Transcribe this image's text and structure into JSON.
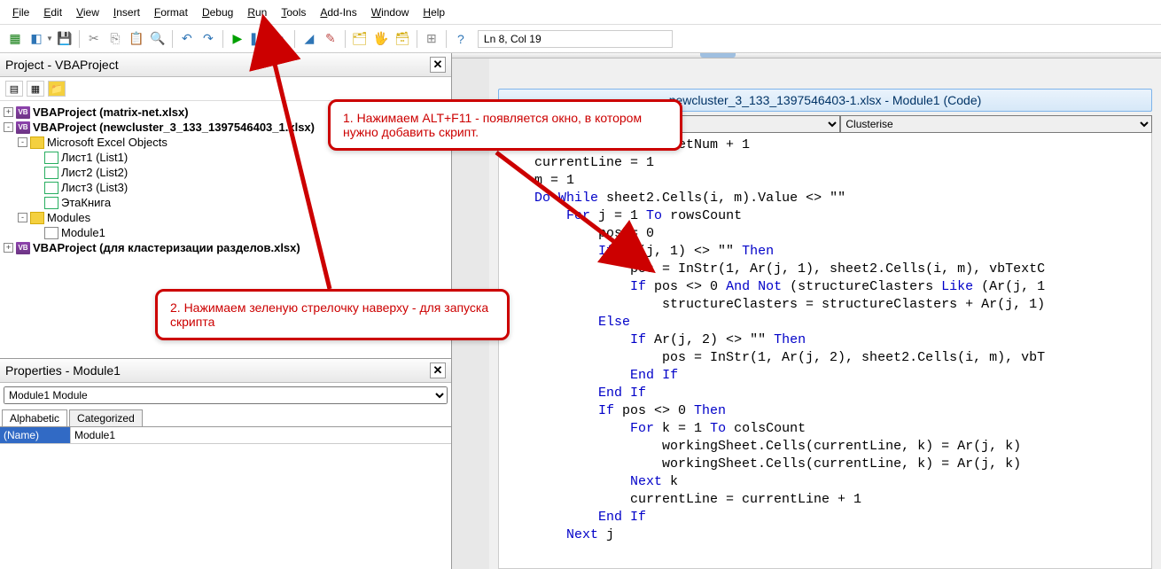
{
  "menu": [
    "File",
    "Edit",
    "View",
    "Insert",
    "Format",
    "Debug",
    "Run",
    "Tools",
    "Add-Ins",
    "Window",
    "Help"
  ],
  "status": "Ln 8, Col 19",
  "project_header": "Project - VBAProject",
  "tree": [
    {
      "ind": 0,
      "exp": "+",
      "icon": "vba",
      "text": "VBAProject (matrix-net.xlsx)",
      "bold": true
    },
    {
      "ind": 0,
      "exp": "-",
      "icon": "vba",
      "text": "VBAProject (newcluster_3_133_1397546403_1.xlsx)",
      "bold": true
    },
    {
      "ind": 1,
      "exp": "-",
      "icon": "fold",
      "text": "Microsoft Excel Objects"
    },
    {
      "ind": 2,
      "exp": "",
      "icon": "sheet",
      "text": "Лист1 (List1)"
    },
    {
      "ind": 2,
      "exp": "",
      "icon": "sheet",
      "text": "Лист2 (List2)"
    },
    {
      "ind": 2,
      "exp": "",
      "icon": "sheet",
      "text": "Лист3 (List3)"
    },
    {
      "ind": 2,
      "exp": "",
      "icon": "sheet",
      "text": "ЭтаКнига"
    },
    {
      "ind": 1,
      "exp": "-",
      "icon": "fold",
      "text": "Modules"
    },
    {
      "ind": 2,
      "exp": "",
      "icon": "mod",
      "text": "Module1"
    },
    {
      "ind": 0,
      "exp": "+",
      "icon": "vba",
      "text": "VBAProject (для кластеризации разделов.xlsx)",
      "bold": true
    }
  ],
  "properties_header": "Properties - Module1",
  "prop_selector": "Module1 Module",
  "prop_tabs": [
    "Alphabetic",
    "Categorized"
  ],
  "prop_name_key": "(Name)",
  "prop_name_val": "Module1",
  "code_title": "newcluster_3_133_1397546403-1.xlsx - Module1 (Code)",
  "code_left_sel": "",
  "code_right_sel": "Clusterise",
  "callout1": "1. Нажимаем ALT+F11  - появляется окно, в котором нужно добавить скрипт.",
  "callout2": "2.  Нажимаем зеленую стрелочку наверху - для запуска скрипта",
  "code_lines": [
    {
      "t": "etNum = workingSheetNum + 1",
      "ind": 0
    },
    {
      "t": "currentLine = 1",
      "ind": 0
    },
    {
      "t": "m = 1",
      "ind": 0
    },
    {
      "t": "Do While sheet2.Cells(i, m).Value <> \"\"",
      "ind": 0,
      "kw": [
        "Do",
        "While"
      ]
    },
    {
      "t": "For j = 1 To rowsCount",
      "ind": 1,
      "kw": [
        "For",
        "To"
      ]
    },
    {
      "t": "pos = 0",
      "ind": 2
    },
    {
      "t": "If Ar(j, 1) <> \"\" Then",
      "ind": 2,
      "kw": [
        "If",
        "Then"
      ]
    },
    {
      "t": "pos = InStr(1, Ar(j, 1), sheet2.Cells(i, m), vbTextC",
      "ind": 3
    },
    {
      "t": "If pos <> 0 And Not (structureClasters Like (Ar(j, 1",
      "ind": 3,
      "kw": [
        "If",
        "And",
        "Not",
        "Like"
      ]
    },
    {
      "t": "structureClasters = structureClasters + Ar(j, 1)",
      "ind": 4
    },
    {
      "t": "Else",
      "ind": 2,
      "kw": [
        "Else"
      ]
    },
    {
      "t": "If Ar(j, 2) <> \"\" Then",
      "ind": 3,
      "kw": [
        "If",
        "Then"
      ]
    },
    {
      "t": "pos = InStr(1, Ar(j, 2), sheet2.Cells(i, m), vbT",
      "ind": 4
    },
    {
      "t": "End If",
      "ind": 3,
      "kw": [
        "End",
        "If"
      ]
    },
    {
      "t": "End If",
      "ind": 2,
      "kw": [
        "End",
        "If"
      ]
    },
    {
      "t": "If pos <> 0 Then",
      "ind": 2,
      "kw": [
        "If",
        "Then"
      ]
    },
    {
      "t": "For k = 1 To colsCount",
      "ind": 3,
      "kw": [
        "For",
        "To"
      ]
    },
    {
      "t": "workingSheet.Cells(currentLine, k) = Ar(j, k)",
      "ind": 4
    },
    {
      "t": "workingSheet.Cells(currentLine, k) = Ar(j, k)",
      "ind": 4
    },
    {
      "t": "Next k",
      "ind": 3,
      "kw": [
        "Next"
      ]
    },
    {
      "t": "currentLine = currentLine + 1",
      "ind": 3
    },
    {
      "t": "End If",
      "ind": 2,
      "kw": [
        "End",
        "If"
      ]
    },
    {
      "t": "Next j",
      "ind": 1,
      "kw": [
        "Next"
      ]
    }
  ]
}
